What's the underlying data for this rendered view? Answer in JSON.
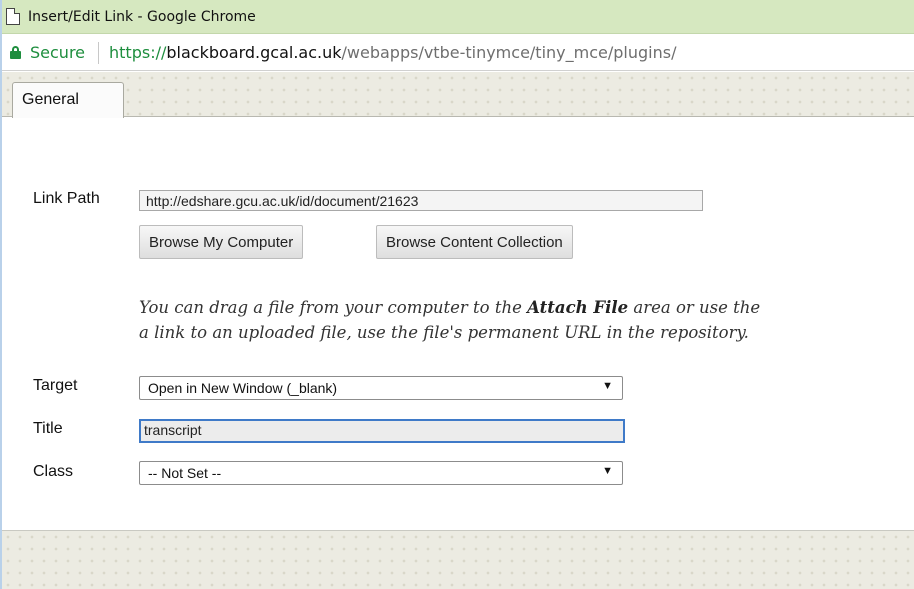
{
  "window": {
    "title": "Insert/Edit Link - Google Chrome"
  },
  "address": {
    "secure_label": "Secure",
    "scheme": "https://",
    "host": "blackboard.gcal.ac.uk",
    "path": "/webapps/vtbe-tinymce/tiny_mce/plugins/"
  },
  "tabs": {
    "general_label": "General"
  },
  "form": {
    "link_path_label": "Link Path",
    "link_path_value": "http://edshare.gcu.ac.uk/id/document/21623",
    "browse_computer_label": "Browse My Computer",
    "browse_content_label": "Browse Content Collection",
    "note_part1": "You can drag a file from your computer to the ",
    "note_bold": "Attach File",
    "note_part2": " area or use the",
    "note_line2": "a link to an uploaded file, use the file's permanent URL in the repository.",
    "target_label": "Target",
    "target_value": "Open in New Window (_blank)",
    "title_label": "Title",
    "title_value": "transcript",
    "class_label": "Class",
    "class_value": "-- Not Set --"
  },
  "icons": {
    "page": "page-icon",
    "lock": "lock-icon",
    "dropdown": "triangle-down-icon"
  },
  "colors": {
    "titlebar": "#d6e8c0",
    "secure_green": "#1e8e3e",
    "focus_border": "#3f7ac8"
  }
}
